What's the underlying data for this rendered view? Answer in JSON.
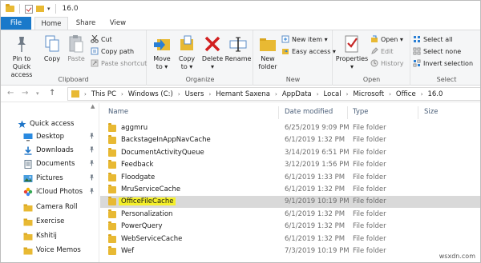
{
  "titlebar": {
    "title": "16.0"
  },
  "tabs": {
    "file": "File",
    "home": "Home",
    "share": "Share",
    "view": "View"
  },
  "ribbon": {
    "clipboard": {
      "label": "Clipboard",
      "pin": "Pin to Quick\naccess",
      "copy": "Copy",
      "paste": "Paste",
      "cut": "Cut",
      "copy_path": "Copy path",
      "paste_shortcut": "Paste shortcut"
    },
    "organize": {
      "label": "Organize",
      "move_to": "Move\nto ▾",
      "copy_to": "Copy\nto ▾",
      "delete": "Delete\n▾",
      "rename": "Rename"
    },
    "new": {
      "label": "New",
      "new_folder": "New\nfolder",
      "new_item": "New item ▾",
      "easy_access": "Easy access ▾"
    },
    "open": {
      "label": "Open",
      "properties": "Properties\n▾",
      "open": "Open ▾",
      "edit": "Edit",
      "history": "History"
    },
    "select": {
      "label": "Select",
      "select_all": "Select all",
      "select_none": "Select none",
      "invert_selection": "Invert selection"
    }
  },
  "address": {
    "crumbs": [
      "This PC",
      "Windows (C:)",
      "Users",
      "Hemant Saxena",
      "AppData",
      "Local",
      "Microsoft",
      "Office",
      "16.0"
    ]
  },
  "navpane": {
    "items": [
      {
        "label": "Quick access",
        "icon": "star-icon",
        "pinned": false
      },
      {
        "label": "Desktop",
        "icon": "desktop-icon",
        "pinned": true
      },
      {
        "label": "Downloads",
        "icon": "download-icon",
        "pinned": true
      },
      {
        "label": "Documents",
        "icon": "documents-icon",
        "pinned": true
      },
      {
        "label": "Pictures",
        "icon": "pictures-icon",
        "pinned": true
      },
      {
        "label": "iCloud Photos",
        "icon": "icloud-photos-icon",
        "pinned": true
      },
      {
        "label": "Camera Roll",
        "icon": "folder-icon",
        "pinned": false
      },
      {
        "label": "Exercise",
        "icon": "folder-icon",
        "pinned": false
      },
      {
        "label": "Kshitij",
        "icon": "folder-icon",
        "pinned": false
      },
      {
        "label": "Voice Memos",
        "icon": "folder-icon",
        "pinned": false
      }
    ]
  },
  "filelist": {
    "headers": {
      "name": "Name",
      "date": "Date modified",
      "type": "Type",
      "size": "Size"
    },
    "rows": [
      {
        "name": "aggmru",
        "date": "6/25/2019 9:09 PM",
        "type": "File folder"
      },
      {
        "name": "BackstageInAppNavCache",
        "date": "6/1/2019 1:32 PM",
        "type": "File folder"
      },
      {
        "name": "DocumentActivityQueue",
        "date": "3/14/2019 6:51 PM",
        "type": "File folder"
      },
      {
        "name": "Feedback",
        "date": "3/12/2019 1:56 PM",
        "type": "File folder"
      },
      {
        "name": "Floodgate",
        "date": "6/1/2019 1:33 PM",
        "type": "File folder"
      },
      {
        "name": "MruServiceCache",
        "date": "6/1/2019 1:32 PM",
        "type": "File folder"
      },
      {
        "name": "OfficeFileCache",
        "date": "9/1/2019 10:19 PM",
        "type": "File folder"
      },
      {
        "name": "Personalization",
        "date": "6/1/2019 1:32 PM",
        "type": "File folder"
      },
      {
        "name": "PowerQuery",
        "date": "6/1/2019 1:32 PM",
        "type": "File folder"
      },
      {
        "name": "WebServiceCache",
        "date": "6/1/2019 1:32 PM",
        "type": "File folder"
      },
      {
        "name": "Wef",
        "date": "7/3/2019 10:19 PM",
        "type": "File folder"
      }
    ]
  },
  "watermark": "wsxdn.com"
}
